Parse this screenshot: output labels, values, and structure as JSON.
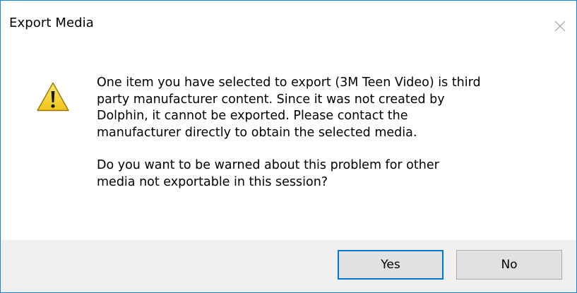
{
  "window": {
    "title": "Export Media"
  },
  "message": {
    "paragraph1": "One item you have selected to export (3M Teen Video) is third\nparty manufacturer content.  Since it was not created by\nDolphin, it cannot be exported.  Please contact the\nmanufacturer directly to obtain the selected media.",
    "paragraph2": "Do you want to be warned about this problem for other\nmedia not exportable in this session?",
    "icon": "warning-icon"
  },
  "buttons": {
    "yes_label": "Yes",
    "no_label": "No"
  },
  "colors": {
    "window_border": "#1883d7",
    "footer_bg": "#f0f0f0",
    "button_bg": "#e1e1e1",
    "button_focus_border": "#0078d7",
    "warning_yellow": "#f8d832",
    "close_glyph": "#a0a0a0"
  }
}
